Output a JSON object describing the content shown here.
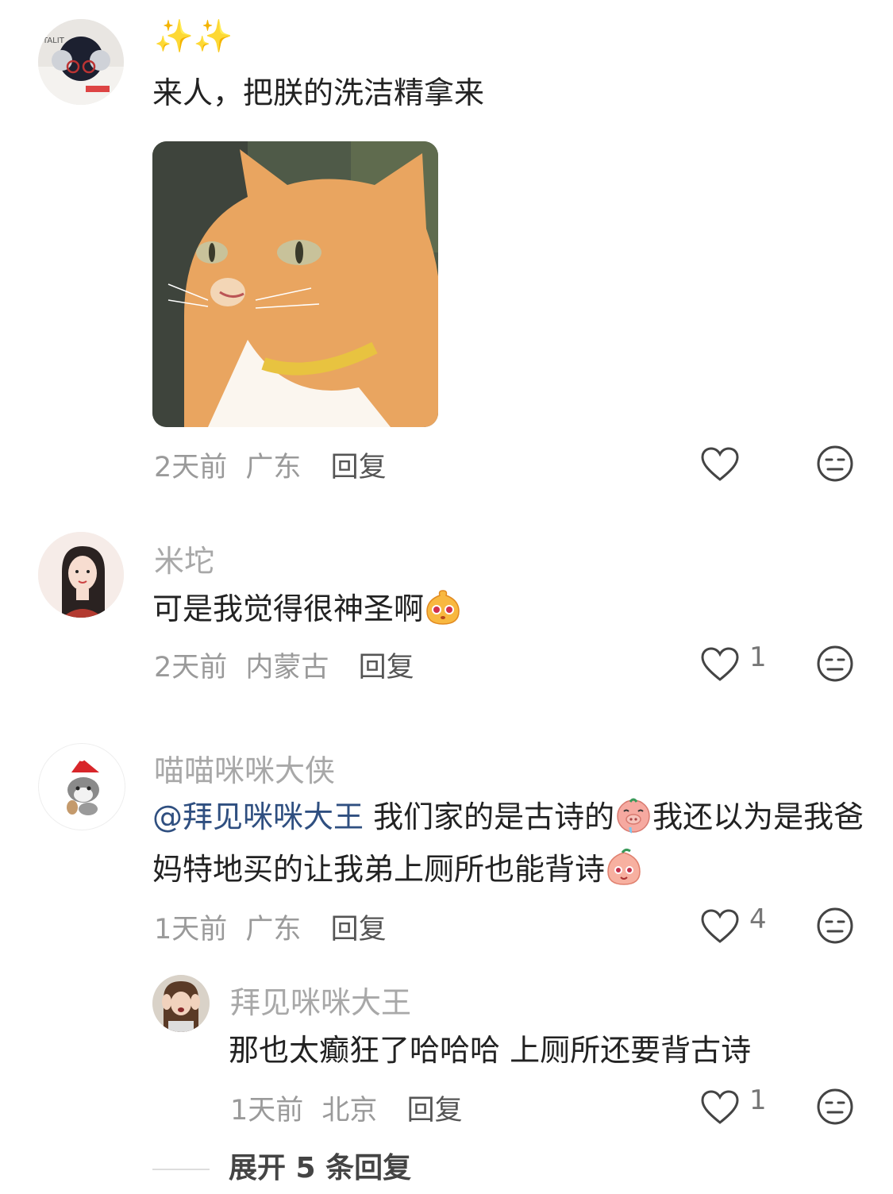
{
  "comments": [
    {
      "username": "✨✨",
      "text": "来人，把朕的洗洁精拿来",
      "time": "2天前",
      "location": "广东",
      "reply_label": "回复",
      "likes": ""
    },
    {
      "username": "米坨",
      "text": "可是我觉得很神圣啊",
      "time": "2天前",
      "location": "内蒙古",
      "reply_label": "回复",
      "likes": "1"
    },
    {
      "username": "喵喵咪咪大侠",
      "mention": "@拜见咪咪大王",
      "text_part1": " 我们家的是古诗的",
      "text_part2": "我还以为是我爸妈特地买的让我弟上厕所也能背诗",
      "time": "1天前",
      "location": "广东",
      "reply_label": "回复",
      "likes": "4"
    },
    {
      "username": "拜见咪咪大王",
      "text": "那也太癫狂了哈哈哈 上厕所还要背古诗",
      "time": "1天前",
      "location": "北京",
      "reply_label": "回复",
      "likes": "1"
    }
  ],
  "expand_label": "展开 5 条回复",
  "icons": {
    "like": "heart-outline-icon",
    "dislike": "neutral-face-icon"
  },
  "colors": {
    "mention": "#2f4f80",
    "username": "#a8a8a8",
    "meta": "#9a9a9a"
  }
}
